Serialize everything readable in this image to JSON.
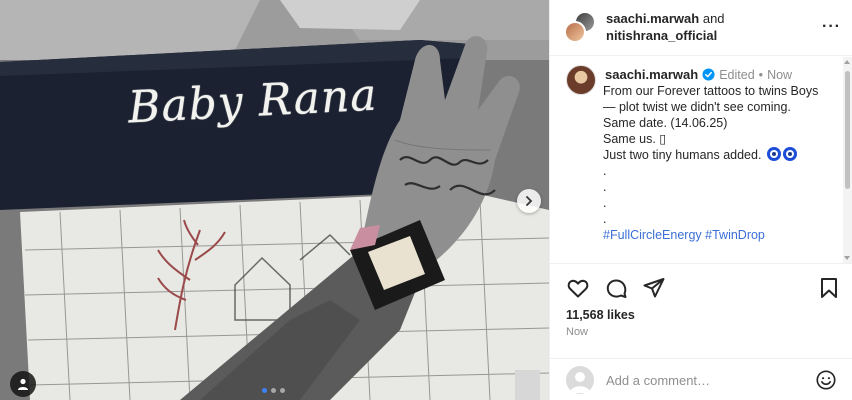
{
  "media": {
    "embroidery_text": "Baby Rana",
    "carousel": {
      "count": 3,
      "active": 0
    }
  },
  "header": {
    "user1": "saachi.marwah",
    "connector": "and",
    "user2": "nitishrana_official",
    "more": "···"
  },
  "caption": {
    "username": "saachi.marwah",
    "edited": "Edited",
    "separator": "•",
    "time": "Now",
    "lines": [
      "From our Forever tattoos to twins Boys",
      "— plot twist we didn't see coming.",
      "Same date. (14.06.25)",
      "Same us. ▯",
      "Just two tiny humans added.",
      ".",
      ".",
      ".",
      "."
    ],
    "hashtag1": "#FullCircleEnergy",
    "hashtag2": "#TwinDrop"
  },
  "stats": {
    "likes": "11,568 likes",
    "time": "Now"
  },
  "comment": {
    "placeholder": "Add a comment…"
  },
  "colors": {
    "accent_blue": "#3b82f6",
    "hashtag": "#3b6fd6",
    "verified": "#0095f6",
    "muted": "#8e8e8e"
  }
}
